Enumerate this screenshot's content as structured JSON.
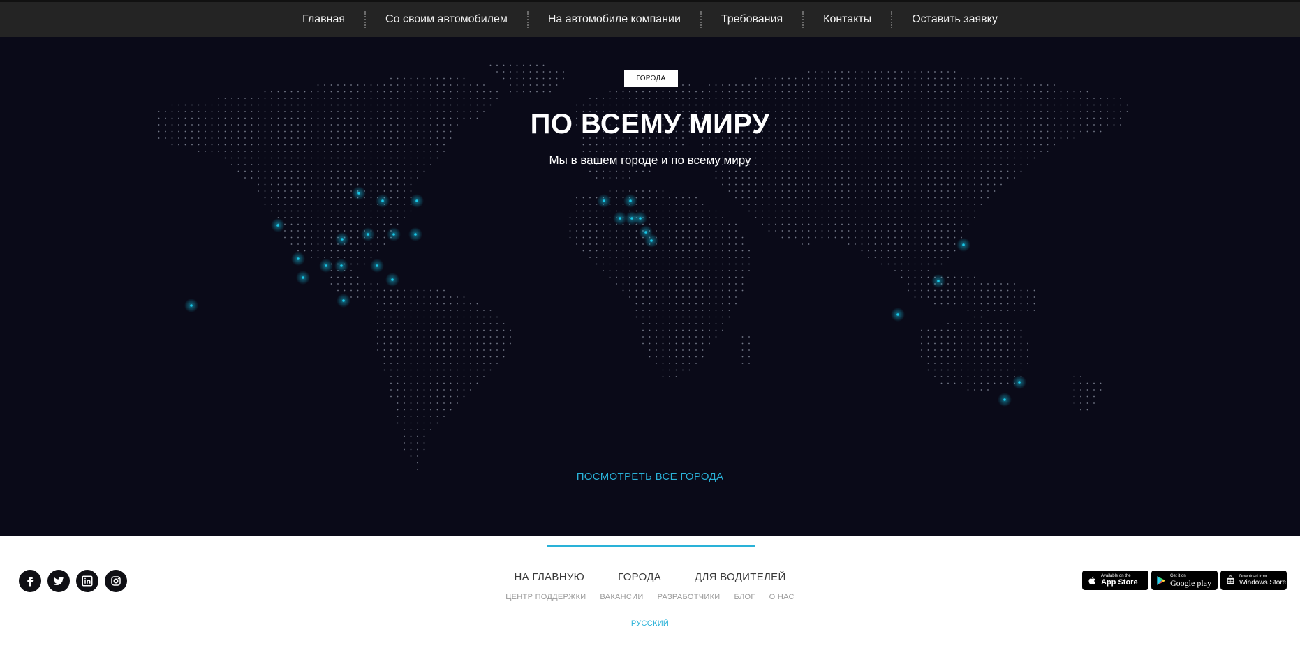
{
  "nav": {
    "items": [
      {
        "label": "Главная"
      },
      {
        "label": "Со своим автомобилем"
      },
      {
        "label": "На автомобиле компании"
      },
      {
        "label": "Требования"
      },
      {
        "label": "Контакты"
      },
      {
        "label": "Оставить заявку"
      }
    ]
  },
  "hero": {
    "badge": "ГОРОДА",
    "title": "ПО ВСЕМУ МИРУ",
    "subtitle": "Мы в вашем городе и по всему миру",
    "cta": "ПОСМОТРЕТЬ ВСЕ ГОРОДА"
  },
  "footer": {
    "main_links": [
      {
        "label": "НА ГЛАВНУЮ"
      },
      {
        "label": "ГОРОДА"
      },
      {
        "label": "ДЛЯ ВОДИТЕЛЕЙ"
      }
    ],
    "sub_links": [
      {
        "label": "ЦЕНТР ПОДДЕРЖКИ"
      },
      {
        "label": "ВАКАНСИИ"
      },
      {
        "label": "РАЗРАБОТЧИКИ"
      },
      {
        "label": "БЛОГ"
      },
      {
        "label": "О НАС"
      }
    ],
    "language": "РУССКИЙ",
    "social": [
      "facebook-icon",
      "twitter-icon",
      "linkedin-icon",
      "instagram-icon"
    ],
    "stores": [
      {
        "small": "Available on the",
        "big": "App Store",
        "icon": "apple-icon"
      },
      {
        "small": "Get it on",
        "big": "Google play",
        "icon": "google-play-icon"
      },
      {
        "small": "Download from",
        "big": "Windows Store",
        "icon": "windows-icon"
      }
    ]
  },
  "colors": {
    "nav_bg": "#242424",
    "hero_bg": "#0a0a18",
    "accent": "#2ab2d8",
    "dot": "#9aa0b0",
    "city_glow": "#19c6e6"
  }
}
